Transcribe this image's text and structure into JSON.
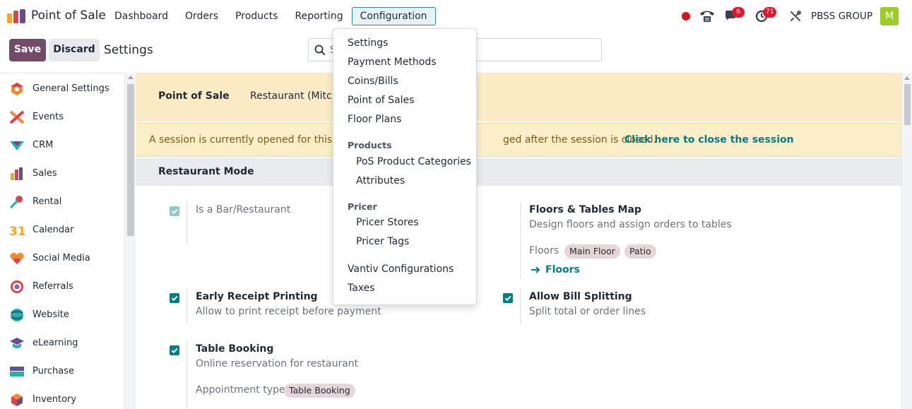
{
  "navbar": {
    "app_name": "Point of Sale",
    "menu": [
      "Dashboard",
      "Orders",
      "Products",
      "Reporting",
      "Configuration"
    ],
    "active_menu": "Configuration",
    "chat_count": "6",
    "activity_count": "71",
    "company": "PBSS GROUP",
    "avatar_letter": "M",
    "colors": {
      "recording_dot": "#e0101b",
      "avatar": "#9ccc28",
      "badge": "#e0172d"
    }
  },
  "control_panel": {
    "save_label": "Save",
    "discard_label": "Discard",
    "title": "Settings",
    "search_placeholder": "S",
    "colors": {
      "save": "#714b67"
    }
  },
  "sidebar": {
    "items": [
      {
        "label": "General Settings",
        "icon": "general-settings-icon"
      },
      {
        "label": "Events",
        "icon": "events-icon"
      },
      {
        "label": "CRM",
        "icon": "crm-icon"
      },
      {
        "label": "Sales",
        "icon": "sales-icon"
      },
      {
        "label": "Rental",
        "icon": "rental-icon"
      },
      {
        "label": "Calendar",
        "icon": "calendar-icon"
      },
      {
        "label": "Social Media",
        "icon": "social-media-icon"
      },
      {
        "label": "Referrals",
        "icon": "referrals-icon"
      },
      {
        "label": "Website",
        "icon": "website-icon"
      },
      {
        "label": "eLearning",
        "icon": "elearning-icon"
      },
      {
        "label": "Purchase",
        "icon": "purchase-icon"
      },
      {
        "label": "Inventory",
        "icon": "inventory-icon"
      }
    ],
    "calendar_number": "31"
  },
  "main": {
    "tabs": [
      "Point of Sale",
      "Restaurant (Mitche"
    ],
    "alert": {
      "text_start": "A session is currently opened for this PoS",
      "text_end": "ged after the session is closed.",
      "link": "Click here to close the session"
    },
    "section_title": "Restaurant Mode",
    "settings": {
      "bar_restaurant": {
        "title": "Is a Bar/Restaurant",
        "checked": true,
        "disabled": true
      },
      "floors_map": {
        "title": "Floors & Tables Map",
        "desc": "Design floors and assign orders to tables",
        "floors_label": "Floors",
        "floors": [
          "Main Floor",
          "Patio"
        ],
        "link": "Floors"
      },
      "early_receipt": {
        "title": "Early Receipt Printing",
        "desc": "Allow to print receipt before payment",
        "checked": true
      },
      "bill_split": {
        "title": "Allow Bill Splitting",
        "desc": "Split total or order lines",
        "checked": true
      },
      "table_booking": {
        "title": "Table Booking",
        "desc": "Online reservation for restaurant",
        "checked": true,
        "appointment_label": "Appointment type",
        "appointment_value": "Table Booking"
      }
    },
    "colors": {
      "tab_band": "#fbecc5",
      "alert_band": "#fbefc9",
      "link": "#017e84",
      "checkbox": "#017e84",
      "tag": "#e6d6d8"
    }
  },
  "dropdown": {
    "items": [
      "Settings",
      "Payment Methods",
      "Coins/Bills",
      "Point of Sales",
      "Floor Plans"
    ],
    "products_header": "Products",
    "products_items": [
      "PoS Product Categories",
      "Attributes"
    ],
    "pricer_header": "Pricer",
    "pricer_items": [
      "Pricer Stores",
      "Pricer Tags"
    ],
    "bottom_items": [
      "Vantiv Configurations",
      "Taxes"
    ]
  }
}
